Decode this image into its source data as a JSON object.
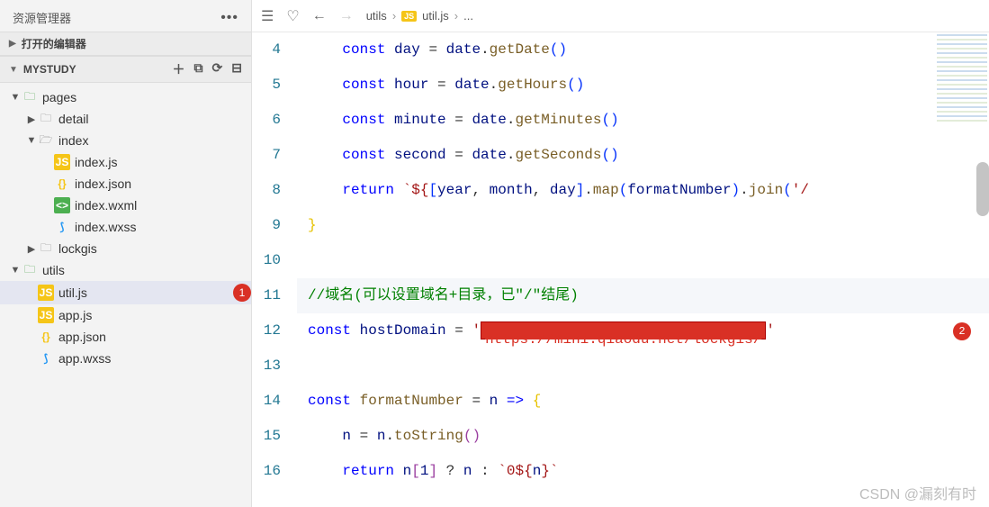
{
  "sidebar": {
    "title": "资源管理器",
    "sections": {
      "openEditors": "打开的编辑器",
      "project": "MYSTUDY"
    },
    "tree": {
      "pages": {
        "label": "pages"
      },
      "detail": {
        "label": "detail"
      },
      "index": {
        "label": "index"
      },
      "indexjs": {
        "label": "index.js"
      },
      "indexjson": {
        "label": "index.json"
      },
      "indexwxml": {
        "label": "index.wxml"
      },
      "indexwxss": {
        "label": "index.wxss"
      },
      "lockgis": {
        "label": "lockgis"
      },
      "utils": {
        "label": "utils"
      },
      "utiljs": {
        "label": "util.js"
      },
      "appjs": {
        "label": "app.js"
      },
      "appjson": {
        "label": "app.json"
      },
      "appwxss": {
        "label": "app.wxss"
      }
    },
    "badge1": "1"
  },
  "breadcrumb": {
    "p1": "utils",
    "p2": "util.js",
    "p3": "..."
  },
  "badge2": "2",
  "code": {
    "lineNumbers": [
      "4",
      "5",
      "6",
      "7",
      "8",
      "9",
      "10",
      "11",
      "12",
      "13",
      "14",
      "15",
      "16"
    ],
    "const": "const",
    "return": "return",
    "day": "day",
    "hour": "hour",
    "minute": "minute",
    "second": "second",
    "date": "date",
    "eq": " = ",
    "dot": ".",
    "getDate": "getDate",
    "getHours": "getHours",
    "getMinutes": "getMinutes",
    "getSeconds": "getSeconds",
    "year": "year",
    "month": "month",
    "map": "map",
    "formatNumber": "formatNumber",
    "join": "join",
    "joinArg": "'/",
    "tplOpen": "`${",
    "tplClose": "}`",
    "comment11": "//域名(可以设置域名+目录，已\"/\"结尾)",
    "hostDomain": "hostDomain",
    "hostStrOpen": "'",
    "hostStrClose": "'",
    "redactedText": "https://mini.qiaodu.net/lockgis/",
    "n": "n",
    "arrow": "=>",
    "toString": "toString",
    "idx1": "1",
    "tern": " ? ",
    "colon": " : ",
    "zeroTpl": "`0${",
    "closeTpl": "}`"
  },
  "watermark": "CSDN @漏刻有时"
}
